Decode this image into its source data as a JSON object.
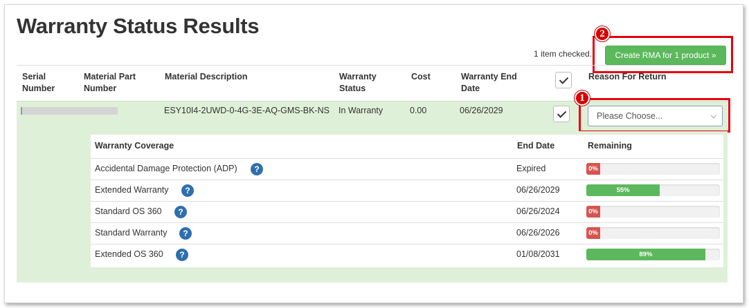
{
  "page_title": "Warranty Status Results",
  "selection_status": "1 item checked.",
  "create_rma_label": "Create RMA for 1 product »",
  "callouts": [
    "1",
    "2"
  ],
  "columns": {
    "serial": "Serial Number",
    "material_part": "Material Part Number",
    "description": "Material Description",
    "warranty_status": "Warranty Status",
    "cost": "Cost",
    "end_date": "Warranty End Date",
    "reason": "Reason For Return"
  },
  "product": {
    "description": "ESY10I4-2UWD-0-4G-3E-AQ-GMS-BK-NS",
    "warranty_status": "In Warranty",
    "cost": "0.00",
    "end_date": "06/26/2029",
    "checked": true,
    "reason_select": "Please Choose..."
  },
  "coverage_header": {
    "coverage": "Warranty Coverage",
    "end_date": "End Date",
    "remaining": "Remaining"
  },
  "coverage": [
    {
      "name": "Accidental Damage Protection (ADP)",
      "end_date": "Expired",
      "remaining_label": "0%",
      "remaining_pct": 0
    },
    {
      "name": "Extended Warranty",
      "end_date": "06/26/2029",
      "remaining_label": "55%",
      "remaining_pct": 55
    },
    {
      "name": "Standard OS 360",
      "end_date": "06/26/2024",
      "remaining_label": "0%",
      "remaining_pct": 0
    },
    {
      "name": "Standard Warranty",
      "end_date": "06/26/2026",
      "remaining_label": "0%",
      "remaining_pct": 0
    },
    {
      "name": "Extended OS 360",
      "end_date": "01/08/2031",
      "remaining_label": "89%",
      "remaining_pct": 89
    }
  ],
  "help_glyph": "?",
  "colors": {
    "accent_green": "#5cb85c",
    "row_highlight": "#dff0d8",
    "danger_red": "#d9534f",
    "callout_red": "#e8000b",
    "help_blue": "#2f6fad"
  }
}
